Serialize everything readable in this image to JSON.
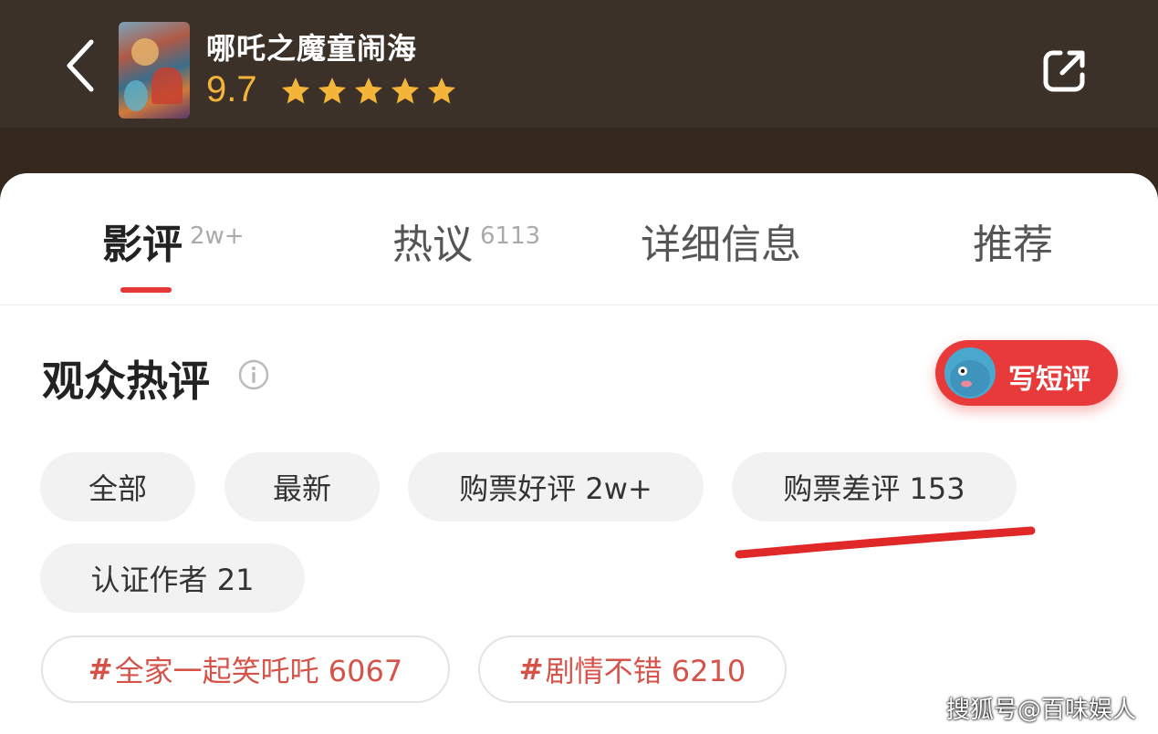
{
  "header": {
    "movie_title": "哪吒之魔童闹海",
    "rating": "9.7",
    "star_count": 5,
    "icons": {
      "back": "chevron-left-icon",
      "share": "share-icon"
    }
  },
  "tabs": [
    {
      "label": "影评",
      "count": "2w+",
      "active": true
    },
    {
      "label": "热议",
      "count": "6113",
      "active": false
    },
    {
      "label": "详细信息",
      "count": "",
      "active": false
    },
    {
      "label": "推荐",
      "count": "",
      "active": false
    }
  ],
  "section": {
    "title": "观众热评",
    "write_button": "写短评"
  },
  "filters": [
    "全部",
    "最新",
    "购票好评 2w+",
    "购票差评 153",
    "认证作者 21"
  ],
  "tags": [
    {
      "hash": "#",
      "label": "全家一起笑吒吒 6067"
    },
    {
      "hash": "#",
      "label": "剧情不错 6210"
    }
  ],
  "watermark": "搜狐号@百味娱人",
  "colors": {
    "accent": "#e83a3a",
    "header_bg": "#3c3128",
    "rating": "#f4b43a",
    "tag_text": "#d6534a"
  }
}
